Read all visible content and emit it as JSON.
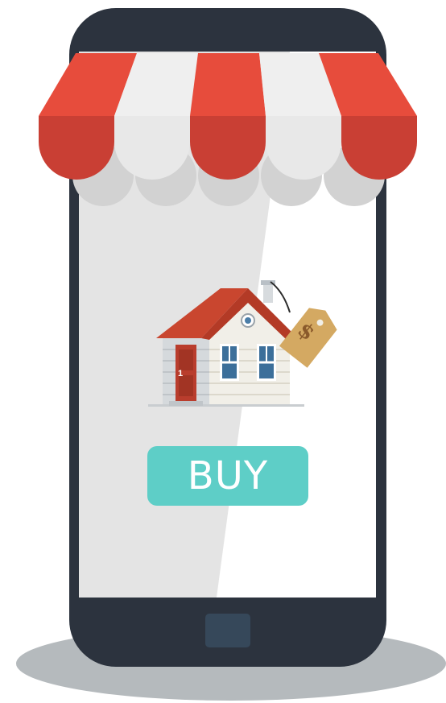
{
  "buy_button": {
    "label": "BUY"
  },
  "house": {
    "door_number": "1"
  },
  "price_tag": {
    "symbol": "$"
  },
  "colors": {
    "phone_body": "#2c333e",
    "screen": "#ffffff",
    "awning_red": "#e74c3c",
    "awning_red_dark": "#c93f34",
    "awning_white": "#efefef",
    "buy_button": "#5ecec7",
    "roof": "#c9462f",
    "door": "#b93d2d",
    "tag": "#d4a962"
  },
  "icons": [
    "storefront-awning",
    "house-icon",
    "price-tag-icon"
  ]
}
